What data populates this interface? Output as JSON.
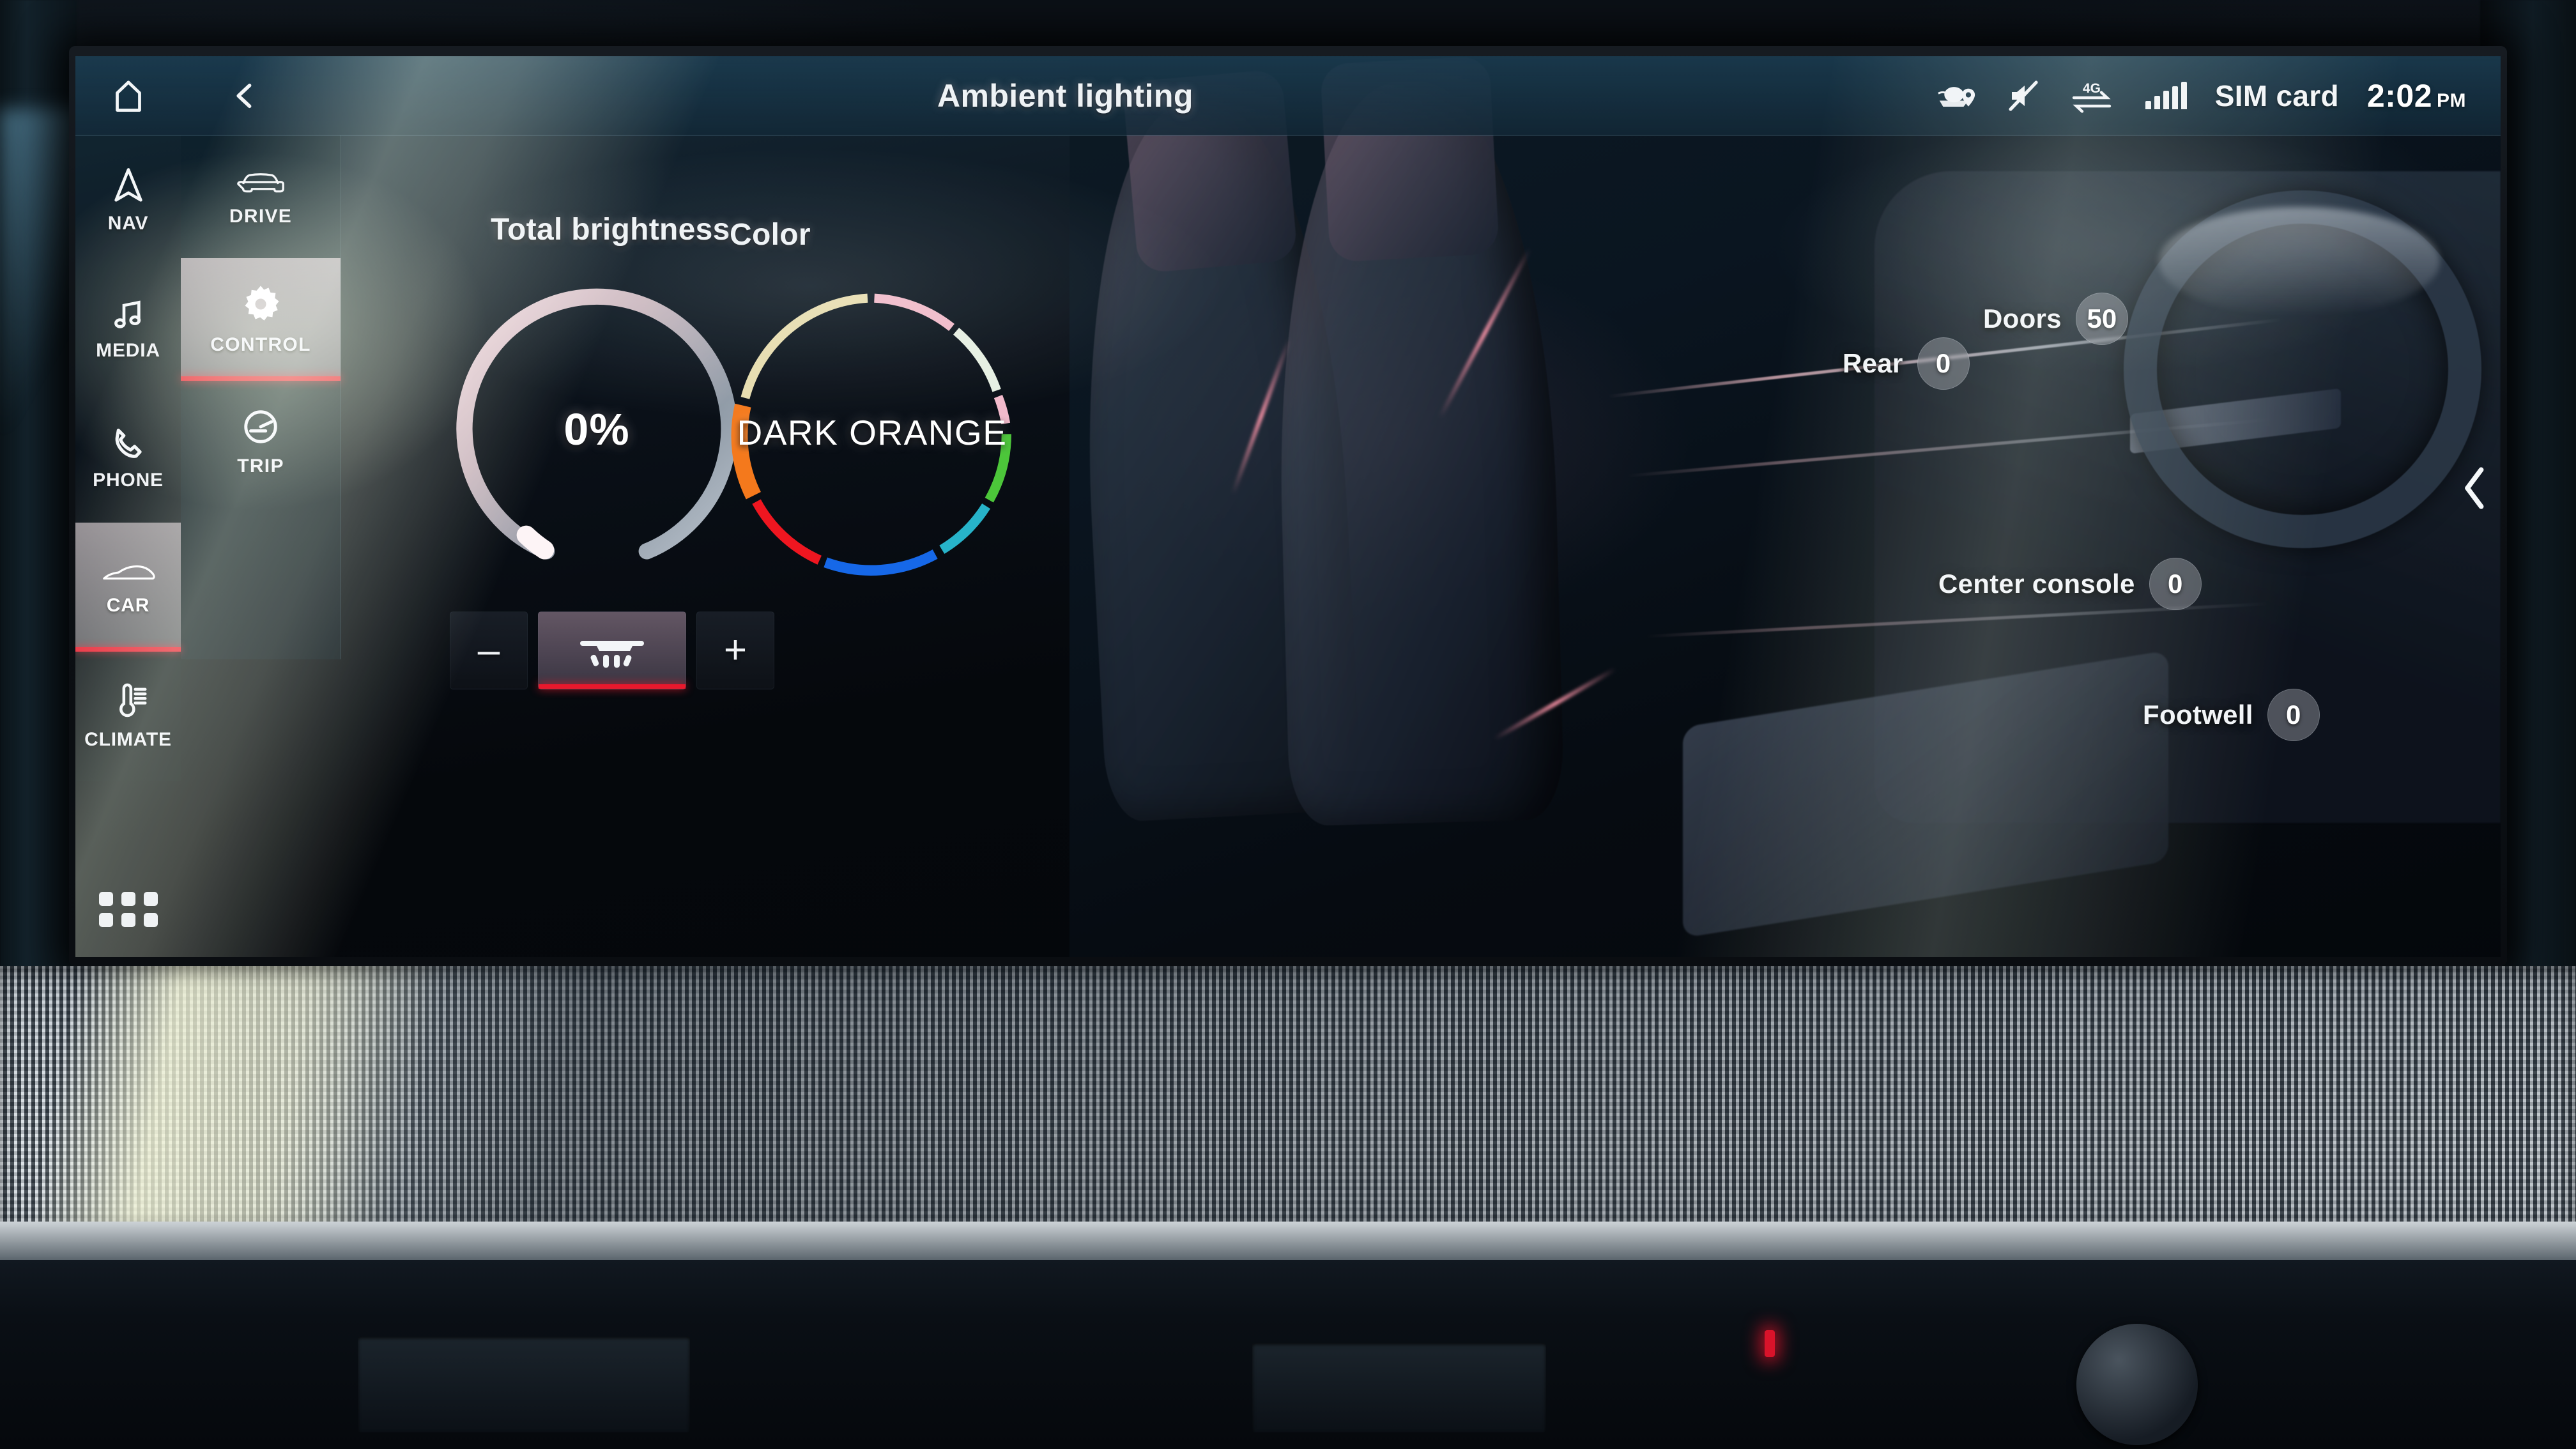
{
  "statusbar": {
    "home_icon": "home-icon",
    "back_icon": "chevron-left-icon",
    "title": "Ambient lighting",
    "map_icon": "map-location-icon",
    "mute_icon": "speaker-muted-icon",
    "data_icon": "4g-data-transfer-icon",
    "signal_icon": "signal-bars-icon",
    "network_label": "SIM card",
    "time": "2:02",
    "ampm": "PM"
  },
  "sidebar": {
    "items": [
      {
        "label": "NAV",
        "icon": "navigation-arrow-icon",
        "active": false
      },
      {
        "label": "MEDIA",
        "icon": "music-note-icon",
        "active": false
      },
      {
        "label": "PHONE",
        "icon": "phone-handset-icon",
        "active": false
      },
      {
        "label": "CAR",
        "icon": "car-side-icon",
        "active": true
      },
      {
        "label": "CLIMATE",
        "icon": "thermometer-icon",
        "active": false
      }
    ],
    "apps_icon": "apps-grid-icon"
  },
  "subbar": {
    "items": [
      {
        "label": "DRIVE",
        "icon": "car-front-icon",
        "active": false
      },
      {
        "label": "CONTROL",
        "icon": "gear-icon",
        "active": true
      },
      {
        "label": "TRIP",
        "icon": "speedometer-icon",
        "active": false
      }
    ]
  },
  "brightness": {
    "title": "Total brightness",
    "value": "0%",
    "percent": 0,
    "minus_label": "–",
    "plus_label": "+",
    "lamp_icon": "ceiling-light-icon",
    "accent": "#e8182c"
  },
  "color": {
    "title": "Color",
    "selected": "DARK ORANGE",
    "segments": [
      {
        "name": "pink",
        "hex": "#f0b9c8"
      },
      {
        "name": "mint-white",
        "hex": "#e2eddc"
      },
      {
        "name": "rose",
        "hex": "#f2b9cb"
      },
      {
        "name": "green",
        "hex": "#4cc63a"
      },
      {
        "name": "cyan",
        "hex": "#27b3c9"
      },
      {
        "name": "blue",
        "hex": "#1668e8"
      },
      {
        "name": "red",
        "hex": "#ef1620"
      },
      {
        "name": "dark-orange",
        "hex": "#f4791c"
      },
      {
        "name": "pale-yellow",
        "hex": "#ead9a8"
      }
    ]
  },
  "zones": [
    {
      "name": "Doors",
      "value": "50"
    },
    {
      "name": "Rear",
      "value": "0"
    },
    {
      "name": "Center console",
      "value": "0"
    },
    {
      "name": "Footwell",
      "value": "0"
    }
  ],
  "page_next_icon": "chevron-left-icon"
}
